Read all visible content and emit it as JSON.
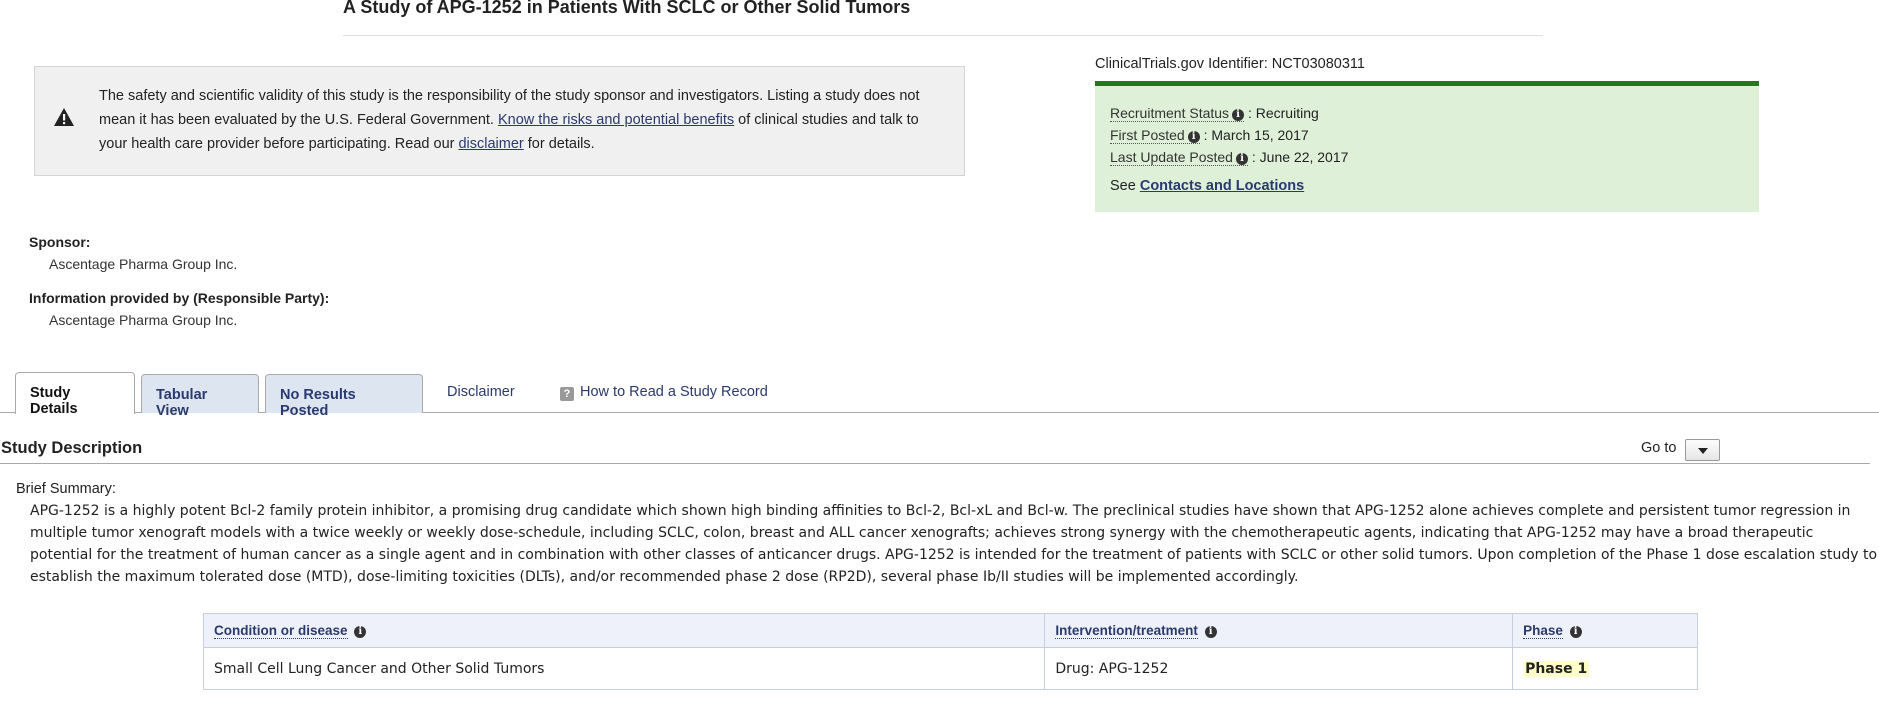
{
  "study": {
    "title": "A Study of APG-1252 in Patients With SCLC or Other Solid Tumors"
  },
  "disclaimer_box": {
    "text_before_link": "The safety and scientific validity of this study is the responsibility of the study sponsor and investigators. Listing a study does not mean it has been evaluated by the U.S. Federal Government. ",
    "risks_link": "Know the risks and potential benefits",
    "text_middle": " of clinical studies and talk to your health care provider before participating. Read our ",
    "disclaimer_link": "disclaimer",
    "text_after": " for details.",
    "icon": "warning-triangle-icon"
  },
  "identifier": {
    "label": "ClinicalTrials.gov Identifier:",
    "value": "NCT03080311"
  },
  "status": {
    "accent_color": "#1f7a1f",
    "recruitment_label": "Recruitment Status",
    "recruitment_value": "Recruiting",
    "first_posted_label": "First Posted",
    "first_posted_value": "March 15, 2017",
    "last_update_label": "Last Update Posted",
    "last_update_value": "June 22, 2017",
    "see_label": "See",
    "contacts_link": "Contacts and Locations"
  },
  "sponsor": {
    "label": "Sponsor:",
    "value": "Ascentage Pharma Group Inc."
  },
  "responsible_party": {
    "label": "Information provided by (Responsible Party):",
    "value": "Ascentage Pharma Group Inc."
  },
  "tabs": {
    "study_details": "Study Details",
    "tabular_view": "Tabular View",
    "no_results": "No Results Posted",
    "disclaimer": "Disclaimer",
    "how_to_read": "How to Read a Study Record"
  },
  "description": {
    "section_title": "Study Description",
    "goto_label": "Go to",
    "brief_summary_label": "Brief Summary:",
    "brief_summary": "APG-1252 is a highly potent Bcl-2 family protein inhibitor, a promising drug candidate which shown high binding affinities to Bcl-2, Bcl-xL and Bcl-w. The preclinical studies have shown that APG-1252 alone achieves complete and persistent tumor regression in multiple tumor xenograft models with a twice weekly or weekly dose-schedule, including SCLC, colon, breast and ALL cancer xenografts; achieves strong synergy with the chemotherapeutic agents, indicating that APG-1252 may have a broad therapeutic potential for the treatment of human cancer as a single agent and in combination with other classes of anticancer drugs. APG-1252 is intended for the treatment of patients with SCLC or other solid tumors. Upon completion of the Phase 1 dose escalation study to establish the maximum tolerated dose (MTD), dose-limiting toxicities (DLTs), and/or recommended phase 2 dose (RP2D), several phase Ib/II studies will be implemented accordingly."
  },
  "conditions_table": {
    "headers": [
      "Condition or disease",
      "Intervention/treatment",
      "Phase"
    ],
    "rows": [
      [
        "Small Cell Lung Cancer and Other Solid Tumors",
        "Drug: APG-1252",
        "Phase 1"
      ]
    ]
  }
}
